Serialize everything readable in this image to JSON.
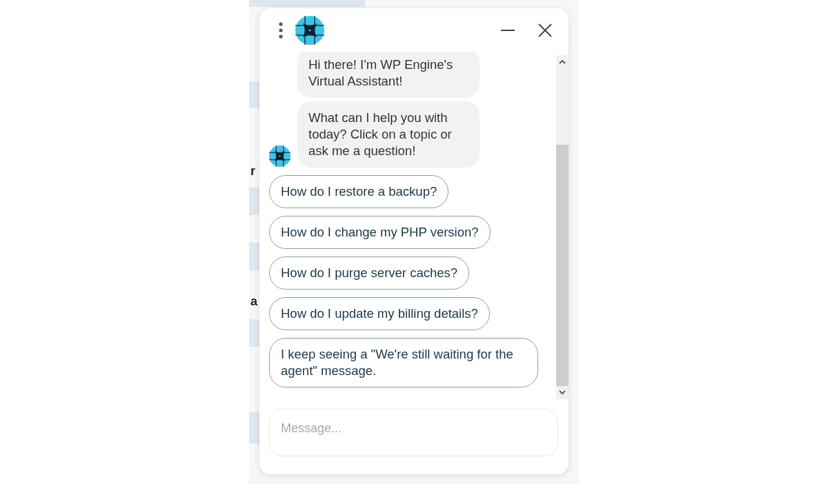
{
  "background": {
    "fragments": [
      "r",
      "a"
    ]
  },
  "chat": {
    "messages": [
      {
        "text": "Hi there! I'm WP Engine's Virtual Assistant!"
      },
      {
        "text": "What can I help you with today? Click on a topic or ask me a question!"
      }
    ],
    "suggestions": [
      "How do I restore a backup?",
      "How do I change my PHP version?",
      "How do I purge server caches?",
      "How do I update my billing details?",
      "I keep seeing a \"We're still waiting for the agent\" message."
    ],
    "input": {
      "placeholder": "Message..."
    }
  }
}
